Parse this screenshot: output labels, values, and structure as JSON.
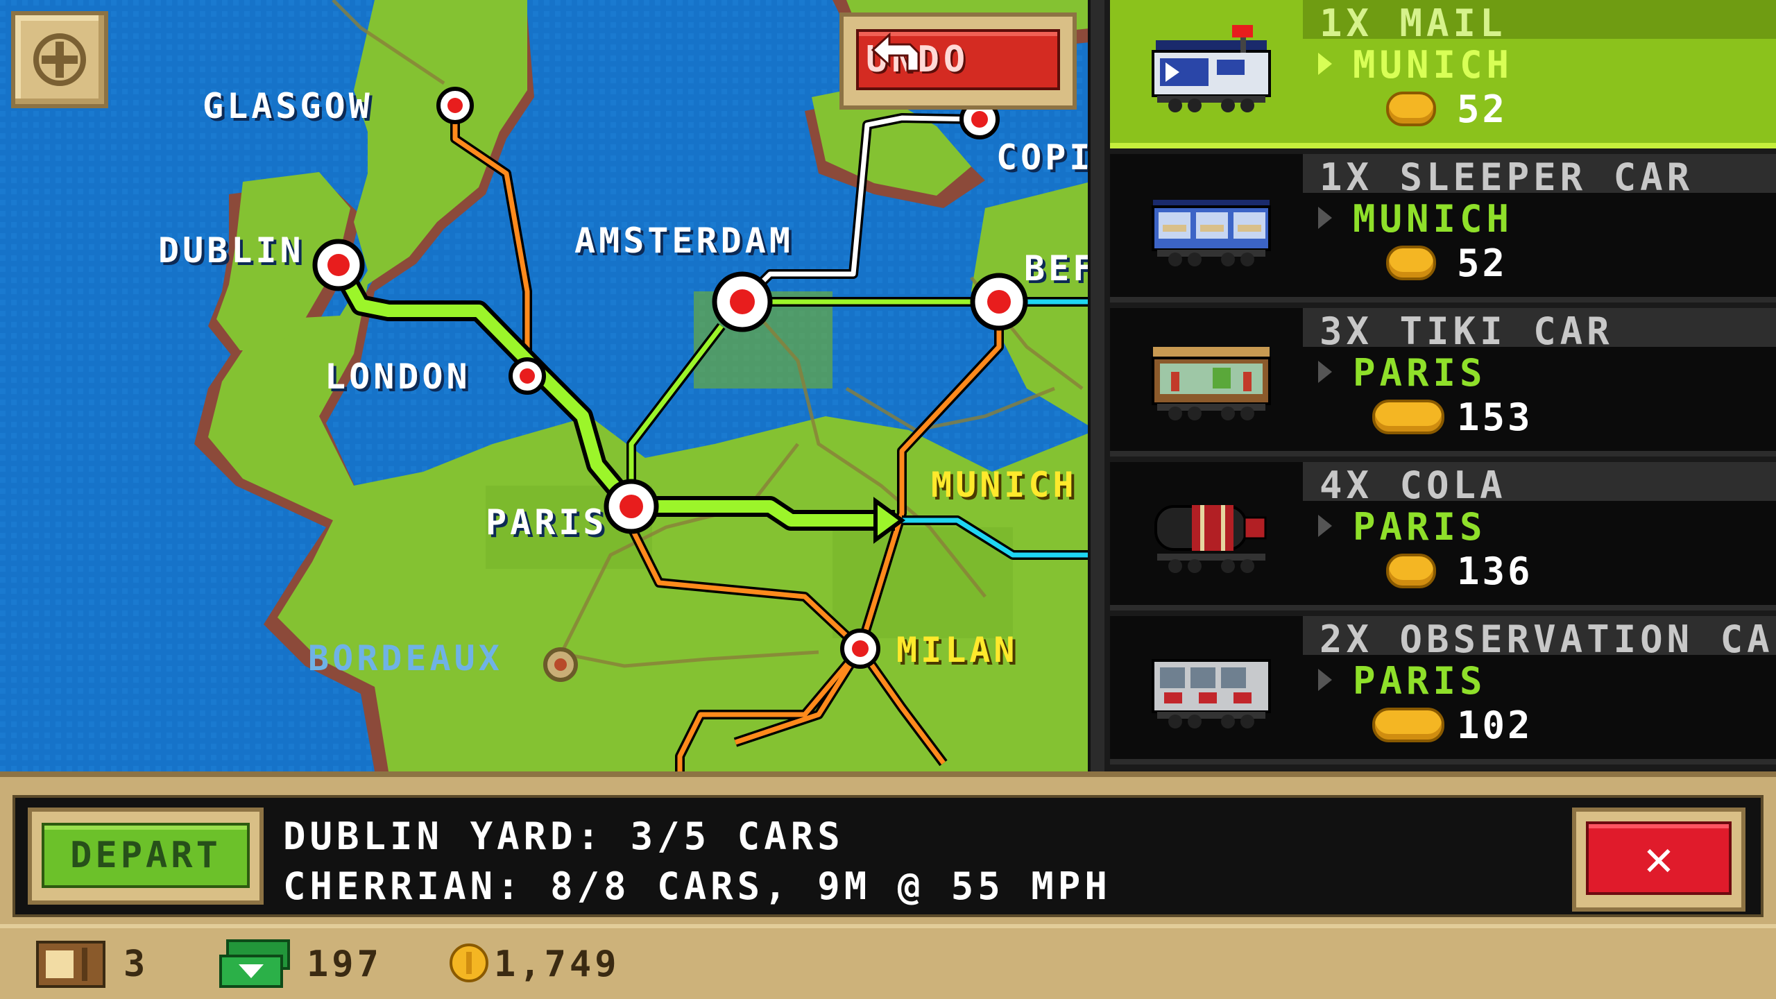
{
  "map": {
    "cities": [
      {
        "name": "GLASGOW",
        "style": "white"
      },
      {
        "name": "DUBLIN",
        "style": "white"
      },
      {
        "name": "AMSTERDAM",
        "style": "white"
      },
      {
        "name": "LONDON",
        "style": "white"
      },
      {
        "name": "PARIS",
        "style": "white"
      },
      {
        "name": "MUNICH",
        "style": "yellow"
      },
      {
        "name": "MILAN",
        "style": "yellow"
      },
      {
        "name": "BORDEAUX",
        "style": "faded"
      },
      {
        "name": "COPI",
        "style": "white"
      },
      {
        "name": "BEF",
        "style": "white"
      }
    ],
    "zoom_icon": "plus-magnifier-icon",
    "undo_label": "UNDO"
  },
  "cars": [
    {
      "qty_name": "1X MAIL",
      "destination": "MUNICH",
      "price": "52",
      "icon": "mail-car-icon",
      "selected": true
    },
    {
      "qty_name": "1X SLEEPER CAR",
      "destination": "MUNICH",
      "price": "52",
      "icon": "sleeper-car-icon",
      "selected": false
    },
    {
      "qty_name": "3X TIKI CAR",
      "destination": "PARIS",
      "price": "153",
      "icon": "tiki-car-icon",
      "selected": false
    },
    {
      "qty_name": "4X COLA",
      "destination": "PARIS",
      "price": "136",
      "icon": "cola-car-icon",
      "selected": false
    },
    {
      "qty_name": "2X OBSERVATION CA",
      "destination": "PARIS",
      "price": "102",
      "icon": "observation-car-icon",
      "selected": false
    }
  ],
  "info": {
    "depart_label": "DEPART",
    "line1": "DUBLIN YARD: 3/5 CARS",
    "line2": "CHERRIAN: 8/8 CARS, 9M @ 55 MPH",
    "close_label": "✕"
  },
  "status": {
    "crates": "3",
    "bux": "197",
    "coins": "1,749"
  },
  "colors": {
    "route_selected": "#9cf52a",
    "route_orange": "#ff8a1c",
    "route_white": "#ffffff",
    "route_cyan": "#1fd6f2",
    "ocean": "#1673c9",
    "land": "#84c232"
  }
}
